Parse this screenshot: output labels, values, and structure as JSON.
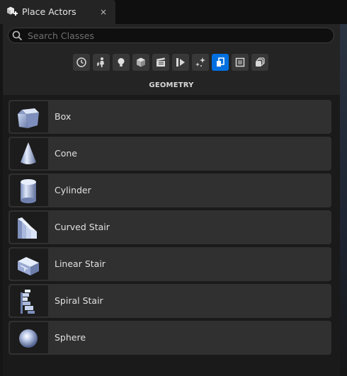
{
  "tab": {
    "title": "Place Actors",
    "close_icon": "×"
  },
  "search": {
    "placeholder": "Search Classes",
    "value": ""
  },
  "categories": [
    {
      "name": "recently-placed",
      "icon": "clock-icon"
    },
    {
      "name": "basic",
      "icon": "basic-icon"
    },
    {
      "name": "lights",
      "icon": "lightbulb-icon"
    },
    {
      "name": "shapes",
      "icon": "cube-icon"
    },
    {
      "name": "cinematic",
      "icon": "clapper-icon"
    },
    {
      "name": "visual-effects",
      "icon": "play-media-icon"
    },
    {
      "name": "effects",
      "icon": "sparkle-icon"
    },
    {
      "name": "geometry",
      "icon": "geometry-icon",
      "active": true
    },
    {
      "name": "volumes",
      "icon": "volume-icon"
    },
    {
      "name": "all-classes",
      "icon": "stack-icon"
    }
  ],
  "section_title": "GEOMETRY",
  "items": [
    {
      "label": "Box",
      "icon": "box-shape-icon"
    },
    {
      "label": "Cone",
      "icon": "cone-shape-icon"
    },
    {
      "label": "Cylinder",
      "icon": "cylinder-shape-icon"
    },
    {
      "label": "Curved Stair",
      "icon": "curved-stair-icon"
    },
    {
      "label": "Linear Stair",
      "icon": "linear-stair-icon"
    },
    {
      "label": "Spiral Stair",
      "icon": "spiral-stair-icon"
    },
    {
      "label": "Sphere",
      "icon": "sphere-shape-icon"
    }
  ],
  "colors": {
    "accent": "#0070e0",
    "panel": "#242424",
    "item": "#303030"
  }
}
